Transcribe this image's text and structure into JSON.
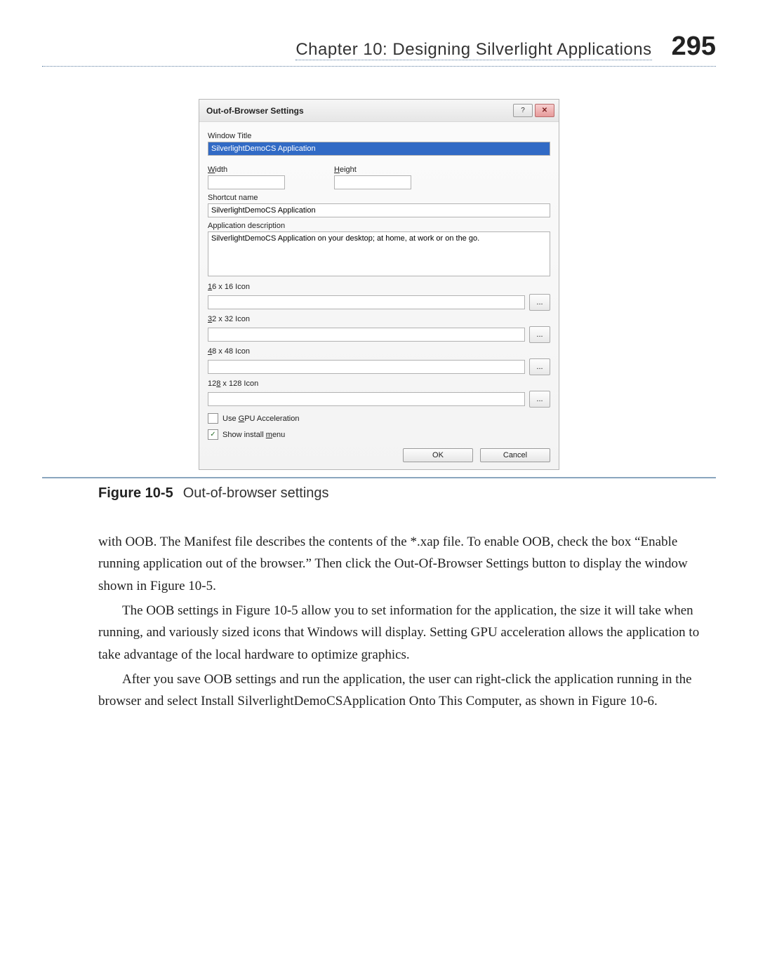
{
  "header": {
    "chapter": "Chapter 10:   Designing Silverlight Applications",
    "page_number": "295"
  },
  "dialog": {
    "title": "Out-of-Browser Settings",
    "help_glyph": "?",
    "close_glyph": "✕",
    "window_title_label": "Window Title",
    "window_title_value": "SilverlightDemoCS Application",
    "width_label_pre": "W",
    "width_label_rest": "idth",
    "width_value": "",
    "height_label_pre": "H",
    "height_label_rest": "eight",
    "height_value": "",
    "shortcut_label": "Shortcut name",
    "shortcut_value": "SilverlightDemoCS Application",
    "appdesc_label": "Application description",
    "appdesc_value": "SilverlightDemoCS Application on your desktop; at home, at work or on the go.",
    "icon16_label": "16 x 16 Icon",
    "icon16_pre": "1",
    "icon32_pre": "3",
    "icon32_rest": "2 x 32 Icon",
    "icon48_pre": "4",
    "icon48_rest": "8 x 48 Icon",
    "icon128_pre": "12",
    "icon128_u": "8",
    "icon128_rest": " x 128 Icon",
    "browse_glyph": "...",
    "gpu_pre": "Use ",
    "gpu_u": "G",
    "gpu_rest": "PU Acceleration",
    "show_pre": "Show install ",
    "show_u": "m",
    "show_rest": "enu",
    "check_mark": "✓",
    "ok": "OK",
    "cancel": "Cancel"
  },
  "figure": {
    "label": "Figure 10-5",
    "caption": "Out-of-browser settings"
  },
  "body": {
    "p1": "with OOB. The Manifest file describes the contents of the *.xap file. To enable OOB, check the box “Enable running application out of the browser.” Then click the Out-Of-Browser Settings button to display the window shown in Figure 10-5.",
    "p2": "The OOB settings in Figure 10-5 allow you to set information for the application, the size it will take when running, and variously sized icons that Windows will display. Setting GPU acceleration allows the application to take advantage of the local hardware to optimize graphics.",
    "p3": "After you save OOB settings and run the application, the user can right-click the application running in the browser and select Install SilverlightDemoCSApplication Onto This Computer, as shown in Figure 10-6."
  }
}
